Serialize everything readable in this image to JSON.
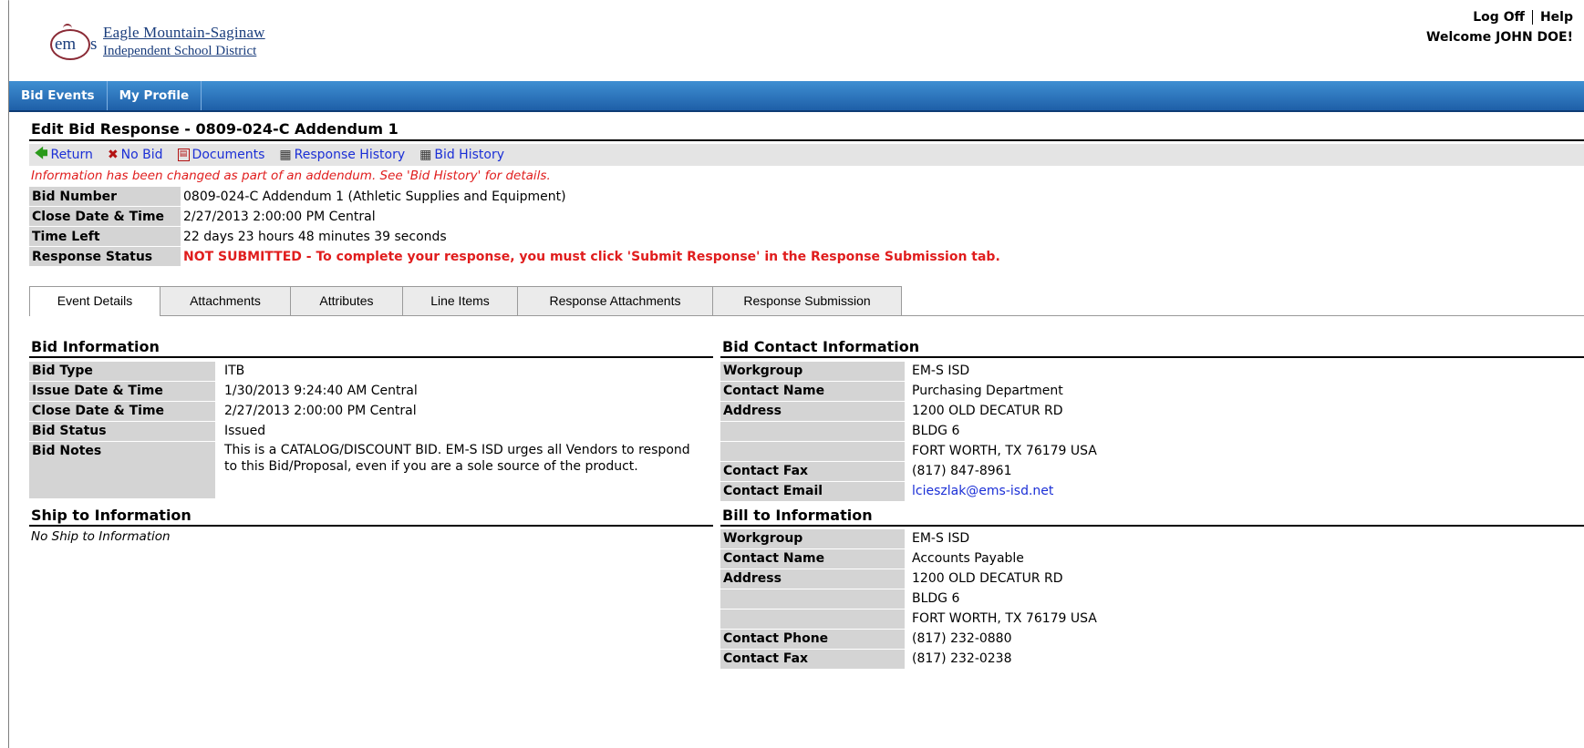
{
  "header": {
    "logo_line1": "Eagle Mountain-Saginaw",
    "logo_line2": "Independent School District",
    "logoff": "Log Off",
    "help": "Help",
    "welcome": "Welcome JOHN DOE!"
  },
  "nav": {
    "items": [
      "Bid Events",
      "My Profile"
    ]
  },
  "page": {
    "title": "Edit Bid Response - 0809-024-C Addendum 1",
    "toolbar": {
      "return": "Return",
      "no_bid": "No Bid",
      "documents": "Documents",
      "response_history": "Response History",
      "bid_history": "Bid History"
    },
    "notice": "Information has been changed as part of an addendum. See 'Bid History' for details."
  },
  "summary": {
    "rows": [
      {
        "label": "Bid Number",
        "value": "0809-024-C Addendum 1 (Athletic Supplies and Equipment)"
      },
      {
        "label": "Close Date & Time",
        "value": "2/27/2013 2:00:00 PM Central"
      },
      {
        "label": "Time Left",
        "value": "22 days 23 hours 48 minutes 39 seconds"
      },
      {
        "label": "Response Status",
        "value": "NOT SUBMITTED - To complete your response, you must click 'Submit Response' in the Response Submission tab."
      }
    ]
  },
  "tabs": [
    "Event Details",
    "Attachments",
    "Attributes",
    "Line Items",
    "Response Attachments",
    "Response Submission"
  ],
  "bid_info": {
    "heading": "Bid Information",
    "rows": [
      {
        "label": "Bid Type",
        "value": "ITB"
      },
      {
        "label": "Issue Date & Time",
        "value": "1/30/2013 9:24:40 AM Central"
      },
      {
        "label": "Close Date & Time",
        "value": "2/27/2013 2:00:00 PM Central"
      },
      {
        "label": "Bid Status",
        "value": "Issued"
      },
      {
        "label": "Bid Notes",
        "value": "This is a CATALOG/DISCOUNT BID. EM-S ISD urges all Vendors to respond to this Bid/Proposal, even if you are a sole source of the product."
      }
    ]
  },
  "ship_info": {
    "heading": "Ship to Information",
    "empty": "No Ship to Information"
  },
  "contact_info": {
    "heading": "Bid Contact Information",
    "rows": [
      {
        "label": "Workgroup",
        "value": "EM-S ISD"
      },
      {
        "label": "Contact Name",
        "value": "Purchasing Department"
      },
      {
        "label": "Address",
        "value": "1200 OLD DECATUR RD"
      },
      {
        "label": "",
        "value": "BLDG 6"
      },
      {
        "label": "",
        "value": "FORT WORTH, TX 76179 USA"
      },
      {
        "label": "Contact Fax",
        "value": "(817) 847-8961"
      },
      {
        "label": "Contact Email",
        "value": "lcieszlak@ems-isd.net"
      }
    ]
  },
  "bill_info": {
    "heading": "Bill to Information",
    "rows": [
      {
        "label": "Workgroup",
        "value": "EM-S ISD"
      },
      {
        "label": "Contact Name",
        "value": "Accounts Payable"
      },
      {
        "label": "Address",
        "value": "1200 OLD DECATUR RD"
      },
      {
        "label": "",
        "value": "BLDG 6"
      },
      {
        "label": "",
        "value": "FORT WORTH, TX 76179 USA"
      },
      {
        "label": "Contact Phone",
        "value": "(817) 232-0880"
      },
      {
        "label": "Contact Fax",
        "value": "(817) 232-0238"
      }
    ]
  }
}
